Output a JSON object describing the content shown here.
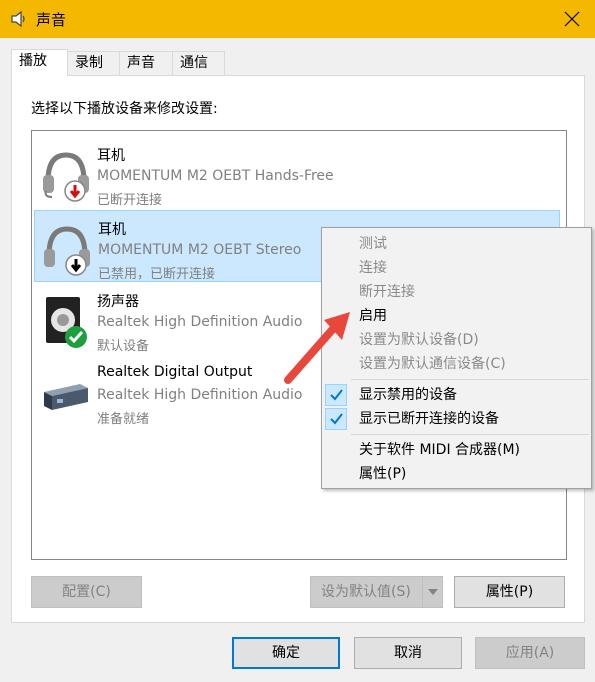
{
  "window": {
    "title": "声音",
    "close_icon": "close-icon"
  },
  "tabs": [
    {
      "label": "播放",
      "active": true
    },
    {
      "label": "录制",
      "active": false
    },
    {
      "label": "声音",
      "active": false
    },
    {
      "label": "通信",
      "active": false
    }
  ],
  "instruction": "选择以下播放设备来修改设置:",
  "devices": [
    {
      "name": "耳机",
      "description": "MOMENTUM M2 OEBT Hands-Free",
      "status": "已断开连接",
      "icon": "headphones-disconnected-icon"
    },
    {
      "name": "耳机",
      "description": "MOMENTUM M2 OEBT Stereo",
      "status": "已禁用，已断开连接",
      "icon": "headphones-disabled-icon",
      "selected": true
    },
    {
      "name": "扬声器",
      "description": "Realtek High Definition Audio",
      "status": "默认设备",
      "icon": "speaker-default-icon"
    },
    {
      "name": "Realtek Digital Output",
      "description": "Realtek High Definition Audio",
      "status": "准备就绪",
      "icon": "digital-output-icon"
    }
  ],
  "context_menu": {
    "items": [
      {
        "label": "测试",
        "disabled": true
      },
      {
        "label": "连接",
        "disabled": true
      },
      {
        "label": "断开连接",
        "disabled": true
      },
      {
        "label": "启用",
        "disabled": false
      },
      {
        "label": "设置为默认设备(D)",
        "disabled": true
      },
      {
        "label": "设置为默认通信设备(C)",
        "disabled": true
      },
      {
        "label": "显示禁用的设备",
        "checked": true
      },
      {
        "label": "显示已断开连接的设备",
        "checked": true
      },
      {
        "label": "关于软件 MIDI 合成器(M)",
        "disabled": false
      },
      {
        "label": "属性(P)",
        "disabled": false
      }
    ]
  },
  "buttons": {
    "configure": "配置(C)",
    "set_default": "设为默认值(S)",
    "properties": "属性(P)",
    "ok": "确定",
    "cancel": "取消",
    "apply": "应用(A)"
  },
  "colors": {
    "titlebar": "#f5b800",
    "selection": "#cce8ff",
    "annotation_arrow": "#e8473b"
  }
}
